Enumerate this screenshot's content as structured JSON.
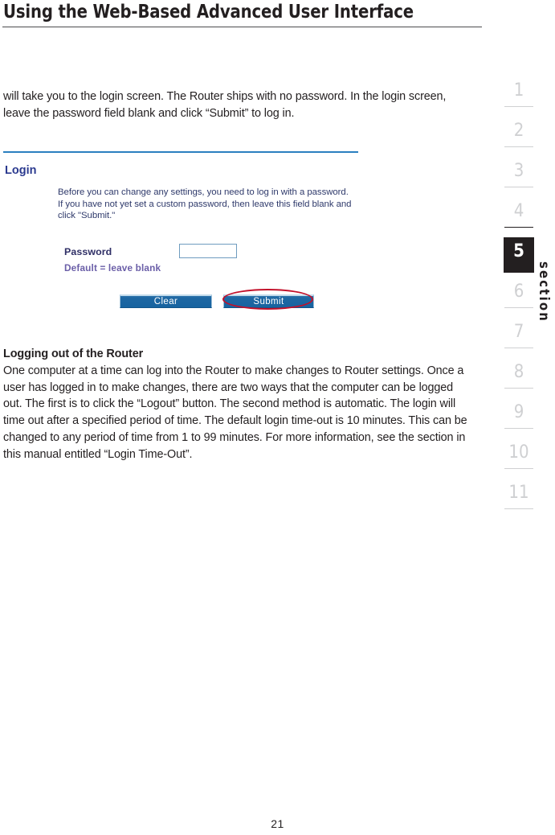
{
  "header": {
    "title": "Using the Web-Based Advanced User Interface"
  },
  "content": {
    "intro_paragraph": "will take you to the login screen. The Router ships with no password. In the login screen, leave the password field blank and click “Submit” to log in.",
    "logout_heading": "Logging out of the Router",
    "logout_paragraph": "One computer at a time can log into the Router to make changes to Router settings. Once a user has logged in to make changes, there are two ways that the computer can be logged out. The first is to click the “Logout” button. The second method is automatic. The login will time out after a specified period of time. The default login time-out is 10 minutes. This can be changed to any period of time from 1 to 99 minutes. For more information, see the section in this manual entitled “Login Time-Out”."
  },
  "router_screenshot": {
    "login_heading": "Login",
    "description": "Before you can change any settings, you need to log in with a password. If you have not yet set a custom password, then leave this field blank and click \"Submit.\"",
    "password_label": "Password",
    "password_value": "",
    "password_placeholder": "",
    "default_note": "Default = leave blank",
    "clear_button": "Clear",
    "submit_button": "Submit",
    "accent_line_color": "#2b7fc0",
    "heading_color": "#2b3a8f",
    "note_color": "#6b5fa8",
    "button_color": "#1763a0",
    "highlight_color": "#c2102a"
  },
  "section_index": {
    "word": "section",
    "active": "5",
    "numbers": [
      "1",
      "2",
      "3",
      "4",
      "5",
      "6",
      "7",
      "8",
      "9",
      "10",
      "11"
    ]
  },
  "footer": {
    "page_number": "21"
  }
}
